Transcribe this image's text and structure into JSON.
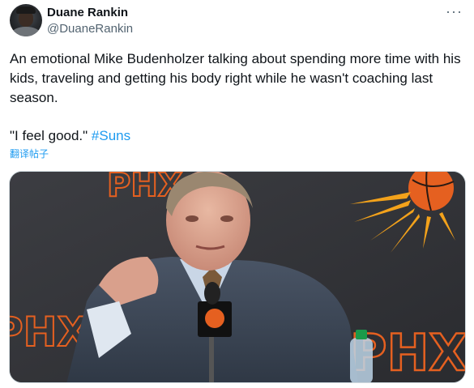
{
  "author": {
    "name": "Duane Rankin",
    "handle": "@DuaneRankin"
  },
  "more_icon": "more-horizontal-icon",
  "tweet": {
    "text": "An emotional Mike Budenholzer talking about spending more time with his kids, traveling and getting his body right while he wasn't coaching last season.",
    "quote": "\"I feel good.\" ",
    "hashtag": "#Suns",
    "translate_label": "翻译帖子"
  },
  "media": {
    "backdrop_text": "PHX"
  },
  "colors": {
    "link": "#1d9bf0",
    "text": "#0f1419",
    "secondary": "#536471",
    "suns_orange": "#e56020",
    "suns_purple": "#1d1160"
  }
}
